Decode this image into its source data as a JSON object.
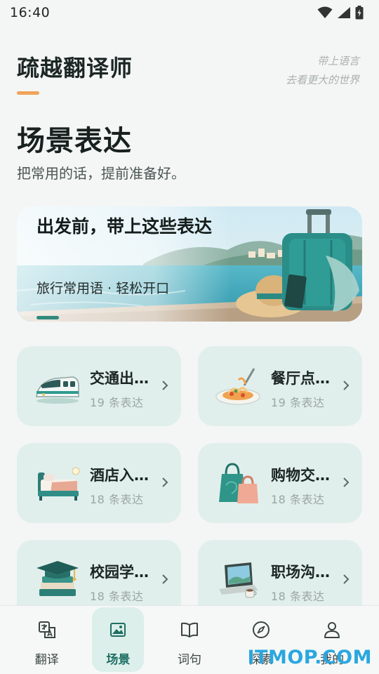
{
  "status_bar": {
    "time": "16:40",
    "icons": [
      "wifi-icon",
      "cellular-signal-icon",
      "battery-charging-icon"
    ]
  },
  "header": {
    "app_title": "疏越翻译师",
    "slogan_line1": "带上语言",
    "slogan_line2": "去看更大的世界",
    "accent_color": "#f0a35a"
  },
  "section": {
    "title": "场景表达",
    "subtitle": "把常用的话，提前准备好。"
  },
  "banner": {
    "title": "出发前，带上这些表达",
    "subtitle": "旅行常用语 · 轻松开口",
    "image": "seaside-luggage-illustration"
  },
  "scenes": [
    {
      "title": "交通出…",
      "count": "19 条表达",
      "icon": "train-icon"
    },
    {
      "title": "餐厅点…",
      "count": "19 条表达",
      "icon": "pasta-icon"
    },
    {
      "title": "酒店入…",
      "count": "18 条表达",
      "icon": "bed-icon"
    },
    {
      "title": "购物交…",
      "count": "18 条表达",
      "icon": "shopping-bag-icon"
    },
    {
      "title": "校园学…",
      "count": "18 条表达",
      "icon": "graduation-cap-icon"
    },
    {
      "title": "职场沟…",
      "count": "18 条表达",
      "icon": "laptop-icon"
    }
  ],
  "nav": {
    "items": [
      {
        "label": "翻译",
        "icon": "translate-icon"
      },
      {
        "label": "场景",
        "icon": "image-icon",
        "active": true
      },
      {
        "label": "词句",
        "icon": "book-icon"
      },
      {
        "label": "探索",
        "icon": "compass-icon"
      },
      {
        "label": "我的",
        "icon": "person-icon"
      }
    ],
    "active_color": "#1f6f63"
  },
  "watermark": "ITMOP.COM"
}
